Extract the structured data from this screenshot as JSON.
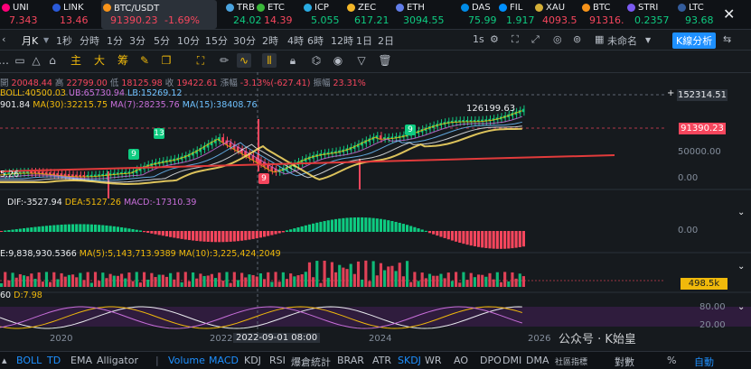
{
  "ticker": [
    {
      "name": "UNI",
      "price": "7.343",
      "dir": "dn",
      "color": "#ff007a"
    },
    {
      "name": "LINK",
      "price": "13.46",
      "dir": "dn",
      "color": "#2a5ada"
    },
    {
      "name": "BTC/USDT",
      "price": "91390.23",
      "change": "-1.69%",
      "dir": "dn",
      "color": "#f7931a",
      "selected": true
    },
    {
      "name": "TRB",
      "price": "24.02",
      "dir": "up",
      "color": "#4aa3df"
    },
    {
      "name": "ETC",
      "price": "14.39",
      "dir": "dn",
      "color": "#3ab83a"
    },
    {
      "name": "ICP",
      "price": "5.055",
      "dir": "up",
      "color": "#29abe2"
    },
    {
      "name": "ZEC",
      "price": "617.21",
      "dir": "up",
      "color": "#f4b728"
    },
    {
      "name": "ETH",
      "price": "3094.55",
      "dir": "up",
      "color": "#627eea"
    },
    {
      "name": "DAS",
      "price": "75.99",
      "dir": "up",
      "color": "#008ce7"
    },
    {
      "name": "FIL",
      "price": "1.917",
      "dir": "up",
      "color": "#0090ff"
    },
    {
      "name": "XAU",
      "price": "4093.5",
      "dir": "dn",
      "color": "#d4af37"
    },
    {
      "name": "BTC",
      "price": "91316.",
      "dir": "dn",
      "color": "#f7931a"
    },
    {
      "name": "STRI",
      "price": "0.2357",
      "dir": "up",
      "color": "#7b5bf2"
    },
    {
      "name": "LTC",
      "price": "93.68",
      "dir": "up",
      "color": "#345d9d"
    }
  ],
  "close_icon": "✕",
  "timeframes": {
    "chevron": "‹",
    "interval": "月K",
    "items": [
      "1秒",
      "分時",
      "1分",
      "3分",
      "5分",
      "10分",
      "15分",
      "30分",
      "2時",
      "4時",
      "6時",
      "12時",
      "1日",
      "2日"
    ],
    "right_tf": "1s",
    "layout_name": "未命名",
    "kline_btn": "K線分析"
  },
  "drawing_tools": {
    "chinese": [
      "主",
      "大",
      "筹"
    ]
  },
  "ohlc": {
    "open_label": "開",
    "open": "20048.44",
    "high_label": "高",
    "high": "22799.00",
    "low_label": "低",
    "low": "18125.98",
    "close_label": "收",
    "close": "19422.61",
    "chg_label": "漲幅",
    "chg": "-3.13%(-627.41)",
    "amp_label": "振幅",
    "amp": "23.31%"
  },
  "boll": {
    "label": "BOLL:40500.03",
    "ub": "UB:65730.94",
    "lb": "LB:15269.12"
  },
  "ma": {
    "m1": "901.84",
    "m30": "MA(30):32215.75",
    "m7": "MA(7):28235.76",
    "m15": "MA(15):38408.76"
  },
  "chart_annot": {
    "high_label": "126199.63",
    "badge9": "9",
    "badge13": "13",
    "badge9b": "9",
    "badge9c": "9",
    "left_small": "5.26"
  },
  "price_axis": {
    "top_box": "152314.51",
    "current": "91390.23",
    "level1": "50000.00",
    "level2": "0.00",
    "macd_zero": "0.00",
    "vol_box": "498.5k",
    "kdj80": "80.00",
    "kdj20": "20.00"
  },
  "macd": {
    "dif": "DIF:-3527.94",
    "dea": "DEA:5127.26",
    "macd": "MACD:-17310.39"
  },
  "vol": {
    "v": "E:9,838,930.5366",
    "ma5": "MA(5):5,143,713.9389",
    "ma10": "MA(10):3,225,424.2049"
  },
  "kdj": {
    "k": "60",
    "d": "D:7.98"
  },
  "time_axis": {
    "labels": [
      "2020",
      "2022",
      "2024",
      "2026"
    ],
    "cursor": "2022-09-01 08:00"
  },
  "watermark": "公众号 · K始皇",
  "indicators": [
    "Volume",
    "MACD",
    "KDJ",
    "RSI",
    "爆倉統計",
    "BRAR",
    "ATR",
    "SKDJ",
    "WR",
    "AO",
    "DPO",
    "DMI",
    "DMA",
    "社區指標",
    "對數",
    "%",
    "自動"
  ],
  "indicators_left": [
    "BOLL",
    "TD",
    "EMA",
    "Alligator"
  ],
  "colors": {
    "bg": "#161a1e",
    "up": "#0ecb81",
    "down": "#f6465d",
    "accent": "#f0b90b",
    "link": "#1e90ff"
  }
}
